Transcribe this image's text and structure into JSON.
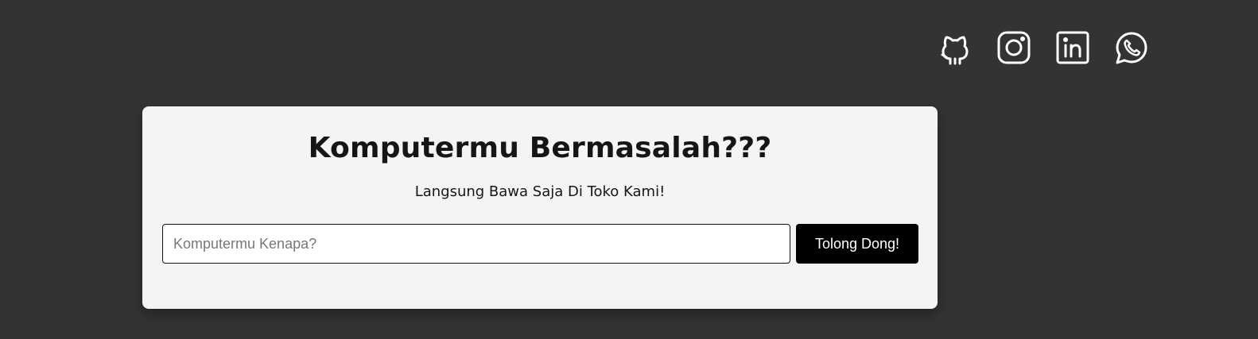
{
  "social": {
    "icons": [
      "github-icon",
      "instagram-icon",
      "linkedin-icon",
      "whatsapp-icon"
    ],
    "icon_color": "#ffffff"
  },
  "hero": {
    "title": "Komputermu Bermasalah???",
    "subtitle": "Langsung Bawa Saja Di Toko Kami!"
  },
  "form": {
    "input_placeholder": "Komputermu Kenapa?",
    "input_value": "",
    "button_label": "Tolong Dong!"
  },
  "colors": {
    "background": "#333333",
    "card": "#f4f4f4",
    "button": "#000000",
    "button_text": "#ffffff"
  }
}
